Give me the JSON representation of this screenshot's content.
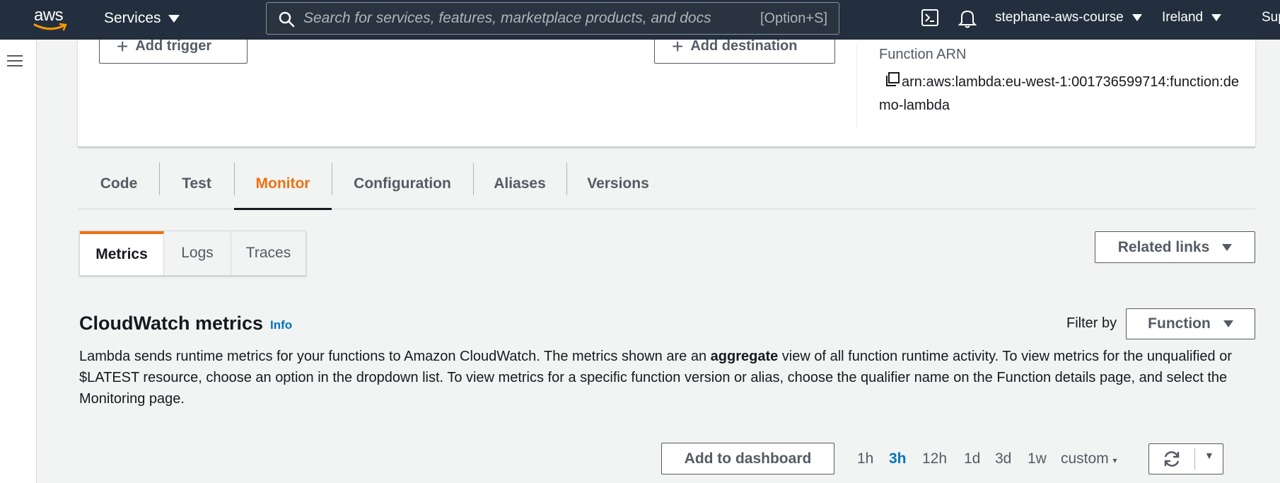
{
  "topnav": {
    "logo_text": "aws",
    "services_label": "Services",
    "search_placeholder": "Search for services, features, marketplace products, and docs",
    "search_shortcut": "[Option+S]",
    "account": "stephane-aws-course",
    "region": "Ireland",
    "support": "Support"
  },
  "overview": {
    "add_trigger": "Add trigger",
    "add_destination": "Add destination",
    "arn_title": "Function ARN",
    "arn_value": "arn:aws:lambda:eu-west-1:001736599714:function:demo-lambda"
  },
  "tabs": [
    {
      "label": "Code"
    },
    {
      "label": "Test"
    },
    {
      "label": "Monitor"
    },
    {
      "label": "Configuration"
    },
    {
      "label": "Aliases"
    },
    {
      "label": "Versions"
    }
  ],
  "monitor_tabs": [
    {
      "label": "Metrics"
    },
    {
      "label": "Logs"
    },
    {
      "label": "Traces"
    }
  ],
  "related_links": "Related links",
  "cloudwatch": {
    "title": "CloudWatch metrics",
    "info": "Info",
    "filter_label": "Filter by",
    "filter_value": "Function",
    "desc_part1": "Lambda sends runtime metrics for your functions to Amazon CloudWatch. The metrics shown are an ",
    "desc_bold": "aggregate",
    "desc_part2": " view of all function runtime activity. To view metrics for the unqualified or $LATEST resource, choose an option in the dropdown list. To view metrics for a specific function version or alias, choose the qualifier name on the Function details page, and select the Monitoring page.",
    "add_to_dashboard": "Add to dashboard",
    "ranges": [
      "1h",
      "3h",
      "12h",
      "1d",
      "3d",
      "1w",
      "custom"
    ],
    "active_range": "3h"
  },
  "colors": {
    "nav_bg": "#232f3e",
    "accent": "#ec7211",
    "link": "#0073bb"
  }
}
